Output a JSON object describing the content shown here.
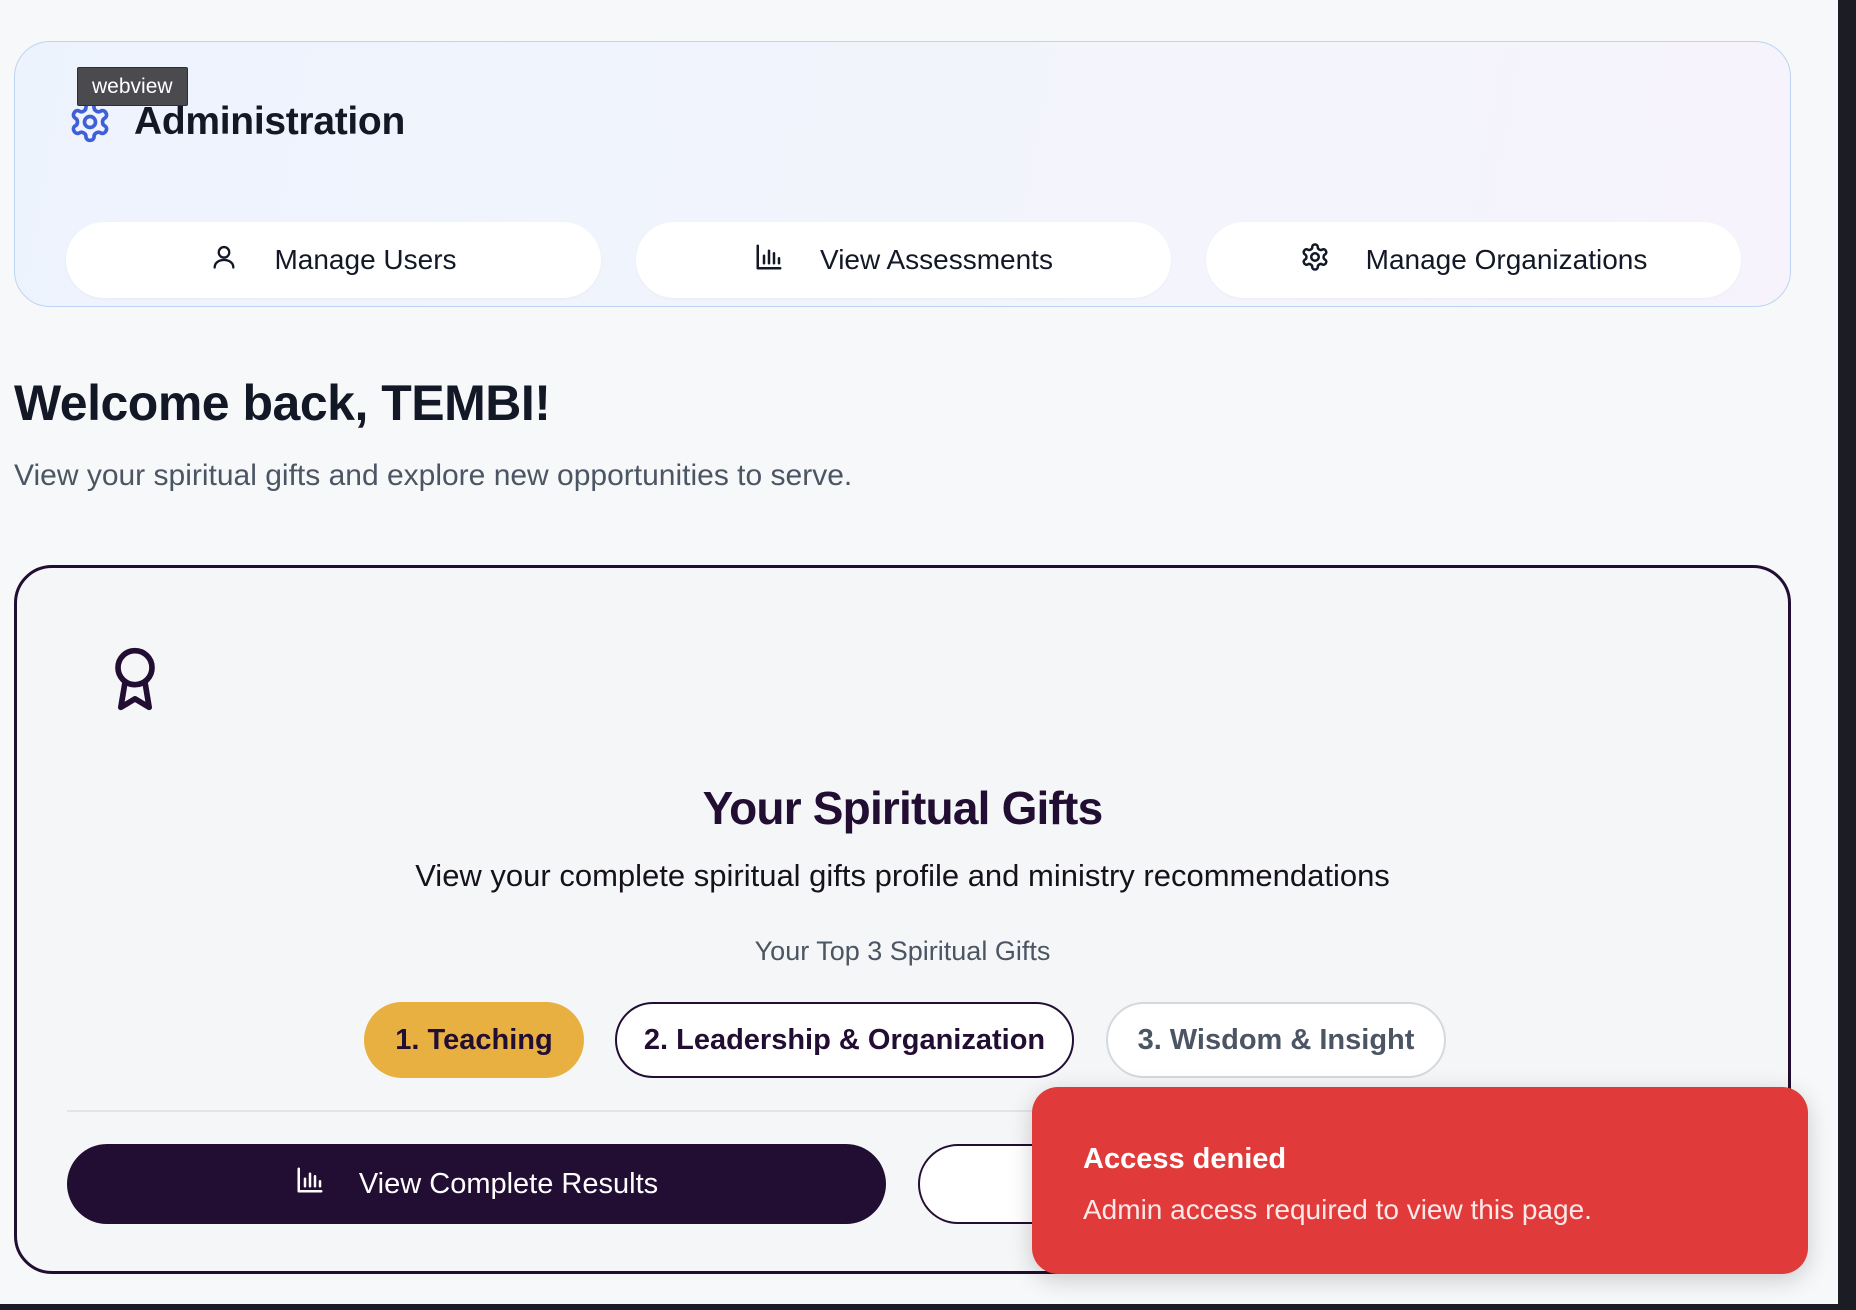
{
  "tooltip": "webview",
  "admin": {
    "title": "Administration",
    "buttons": [
      {
        "label": "Manage Users",
        "icon": "user-icon"
      },
      {
        "label": "View Assessments",
        "icon": "bar-chart-icon"
      },
      {
        "label": "Manage Organizations",
        "icon": "gear-icon"
      }
    ]
  },
  "welcome": {
    "title": "Welcome back, TEMBI!",
    "subtitle": "View your spiritual gifts and explore new opportunities to serve."
  },
  "gifts": {
    "icon": "award-icon",
    "title": "Your Spiritual Gifts",
    "subtitle": "View your complete spiritual gifts profile and ministry recommendations",
    "top_label": "Your Top 3 Spiritual Gifts",
    "top_gifts": [
      "1. Teaching",
      "2. Leadership & Organization",
      "3. Wisdom & Insight"
    ],
    "results_button": "View Complete Results"
  },
  "toast": {
    "title": "Access denied",
    "description": "Admin access required to view this page."
  },
  "colors": {
    "primary": "#220d33",
    "accent_gold": "#e8b040",
    "admin_icon_blue": "#3f5fd8",
    "toast_red": "#e03b3a"
  }
}
